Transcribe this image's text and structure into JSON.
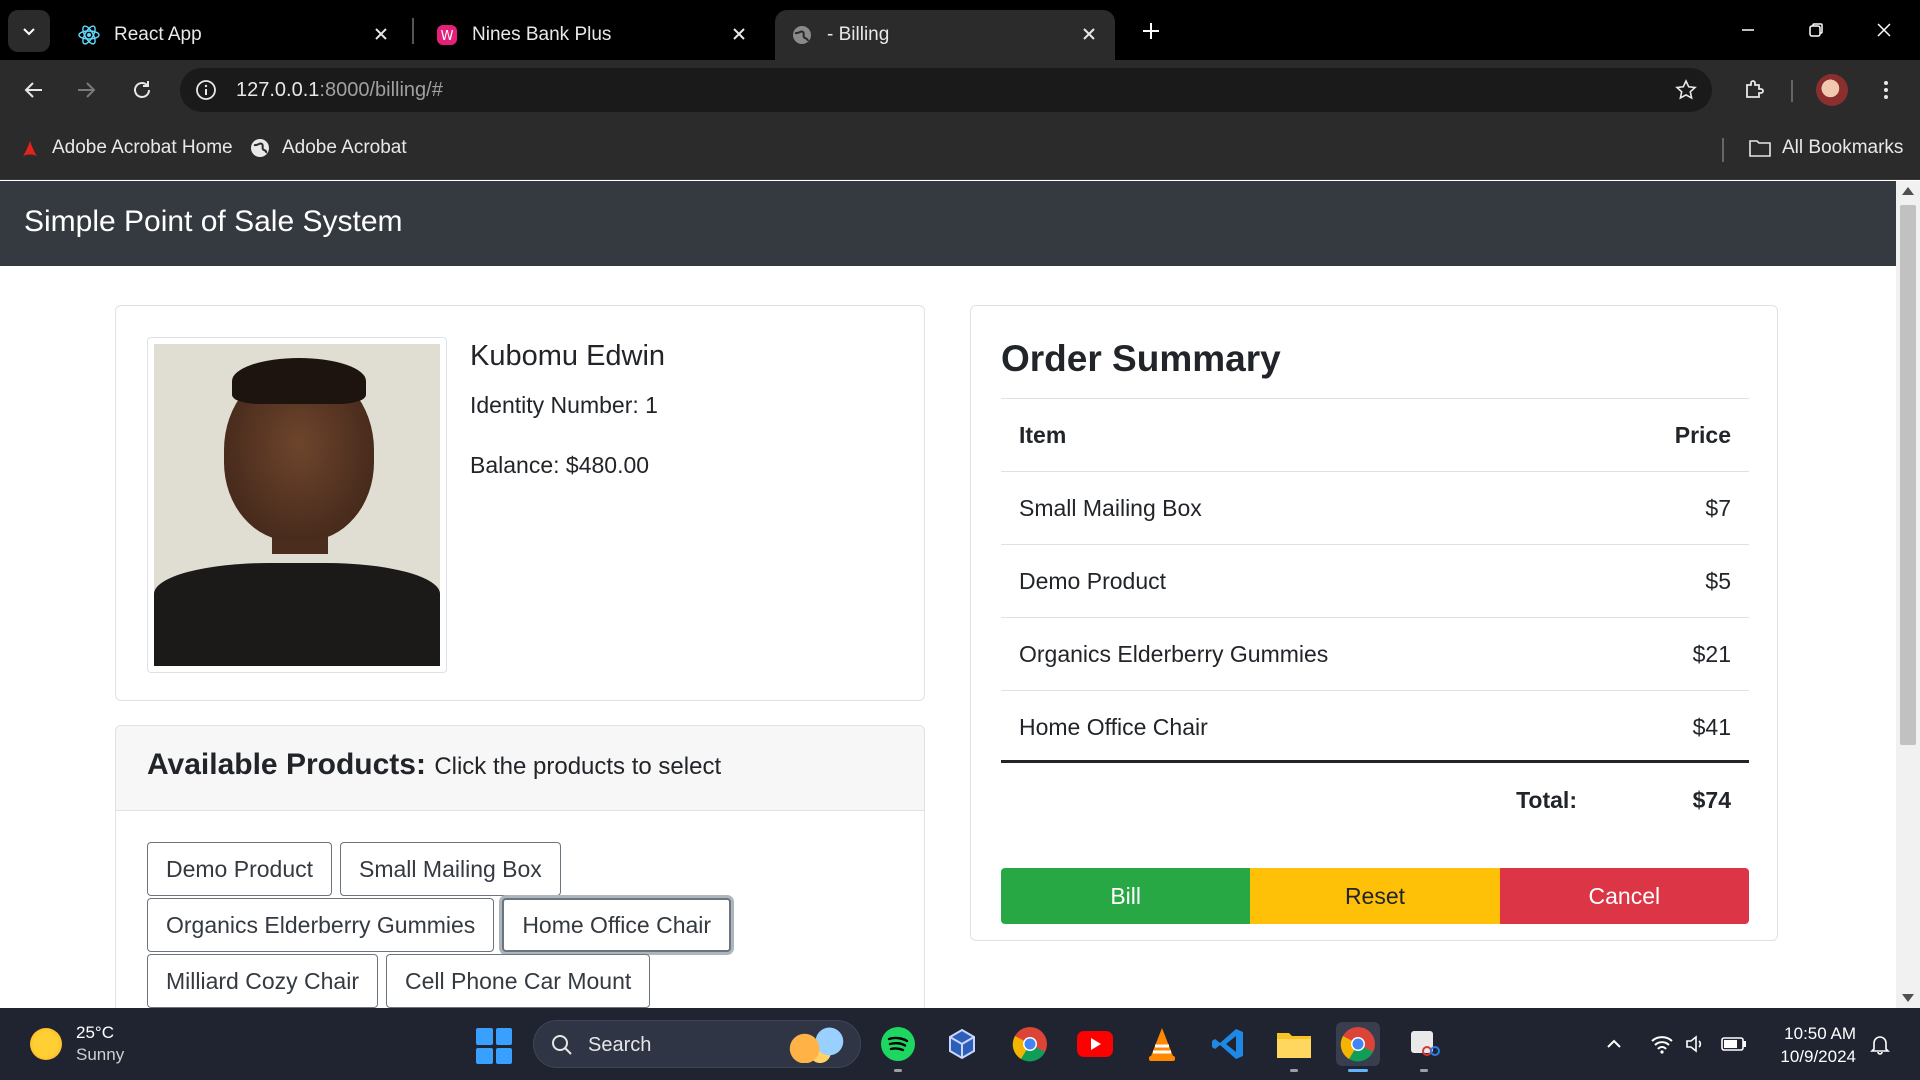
{
  "browser": {
    "tabs": [
      {
        "title": "React App"
      },
      {
        "title": "Nines Bank Plus"
      },
      {
        "title": "- Billing"
      }
    ],
    "url_host": "127.0.0.1",
    "url_rest": ":8000/billing/#",
    "bookmarks": [
      {
        "label": "Adobe Acrobat Home"
      },
      {
        "label": "Adobe Acrobat"
      }
    ],
    "all_bookmarks": "All Bookmarks"
  },
  "app": {
    "brand": "Simple Point of Sale System"
  },
  "customer": {
    "name": "Kubomu Edwin",
    "identity": "Identity Number: 1",
    "balance": "Balance: $480.00"
  },
  "products": {
    "title": "Available Products:",
    "subtitle": "Click the products to select",
    "items": [
      "Demo Product",
      "Small Mailing Box",
      "Organics Elderberry Gummies",
      "Home Office Chair",
      "Milliard Cozy Chair",
      "Cell Phone Car Mount"
    ]
  },
  "summary": {
    "title": "Order Summary",
    "col_item": "Item",
    "col_price": "Price",
    "rows": [
      {
        "item": "Small Mailing Box",
        "price": "$7"
      },
      {
        "item": "Demo Product",
        "price": "$5"
      },
      {
        "item": "Organics Elderberry Gummies",
        "price": "$21"
      },
      {
        "item": "Home Office Chair",
        "price": "$41"
      }
    ],
    "total_label": "Total:",
    "total_value": "$74",
    "actions": {
      "bill": "Bill",
      "reset": "Reset",
      "cancel": "Cancel"
    }
  },
  "taskbar": {
    "temp": "25°C",
    "weather": "Sunny",
    "search": "Search",
    "time": "10:50 AM",
    "date": "10/9/2024"
  },
  "colors": {
    "navbar": "#343a40",
    "bill": "#28a745",
    "reset": "#ffc107",
    "cancel": "#dc3545"
  }
}
